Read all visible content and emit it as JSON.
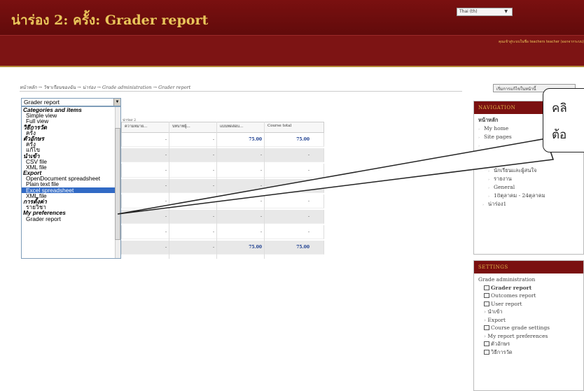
{
  "header": {
    "title": "น่าร่อง 2: ครั้ง: Grader report",
    "lang": "Thai (th)",
    "login": "คุณเข้าสู่ระบบในชื่อ teachers teacher (ออกจากระบบ)"
  },
  "breadcrumb": "หน้าหลัก → วิชาเรียนของฉัน → น่าร่อง → Grade administration → Grader report",
  "select": {
    "value": "Grader report"
  },
  "dropdown": [
    {
      "t": "grp",
      "l": "Categories and items"
    },
    {
      "t": "opt",
      "l": "Simple view"
    },
    {
      "t": "opt",
      "l": "Full view"
    },
    {
      "t": "grp",
      "l": "วิธีการวัด"
    },
    {
      "t": "opt",
      "l": "ครั้ง"
    },
    {
      "t": "grp",
      "l": "ตัวอักษร"
    },
    {
      "t": "opt",
      "l": "ครั้ง"
    },
    {
      "t": "opt",
      "l": "แก้ไข"
    },
    {
      "t": "grp",
      "l": "นำเข้า"
    },
    {
      "t": "opt",
      "l": "CSV file"
    },
    {
      "t": "opt",
      "l": "XML file"
    },
    {
      "t": "grp",
      "l": "Export"
    },
    {
      "t": "opt",
      "l": "OpenDocument spreadsheet"
    },
    {
      "t": "opt",
      "l": "Plain text file"
    },
    {
      "t": "sel",
      "l": "Excel spreadsheet"
    },
    {
      "t": "opt",
      "l": "XML file"
    },
    {
      "t": "grp",
      "l": "การตั้งค่า"
    },
    {
      "t": "opt",
      "l": "รายวิชา"
    },
    {
      "t": "grp",
      "l": "My preferences"
    },
    {
      "t": "opt",
      "l": "Grader report"
    }
  ],
  "grid": {
    "caption": "น่าร่อง 2",
    "headers": [
      "ความหมาย...",
      "บทบาทผู้...",
      "แบบทดสอบ...",
      "Course total"
    ],
    "rows": [
      [
        "-",
        "-",
        "75.00",
        "75.00"
      ],
      [
        "-",
        "-",
        "-",
        "-"
      ],
      [
        "-",
        "-",
        "-",
        "-"
      ],
      [
        "-",
        "-",
        "-",
        "-"
      ],
      [
        "-",
        "-",
        "-",
        "-"
      ],
      [
        "-",
        "-",
        "-",
        "-"
      ],
      [
        "-",
        "-",
        "-",
        "-"
      ],
      [
        "-",
        "-",
        "75.00",
        "75.00"
      ]
    ]
  },
  "sidebar": {
    "edit_button": "เริ่มการแก้ไขในหน้านี้",
    "nav_title": "NAVIGATION",
    "nav": [
      "หน้าหลัก",
      "My home",
      "Site pages",
      "",
      "",
      "น่าร่อง2",
      "นักเรียนและผู้สนใจ",
      "รายงาน",
      "General",
      "18ตุลาคม - 24ตุลาคม",
      "น่าร่อง1"
    ],
    "set_title": "SETTINGS",
    "settings": [
      "Grade administration",
      "Grader report",
      "Outcomes report",
      "User report",
      "นำเข้า",
      "Export",
      "Course grade settings",
      "My report preferences",
      "ตัวอักษร",
      "วิธีการวัด"
    ]
  },
  "callout": {
    "line1": "คลิ",
    "line2": "ต้อ"
  }
}
